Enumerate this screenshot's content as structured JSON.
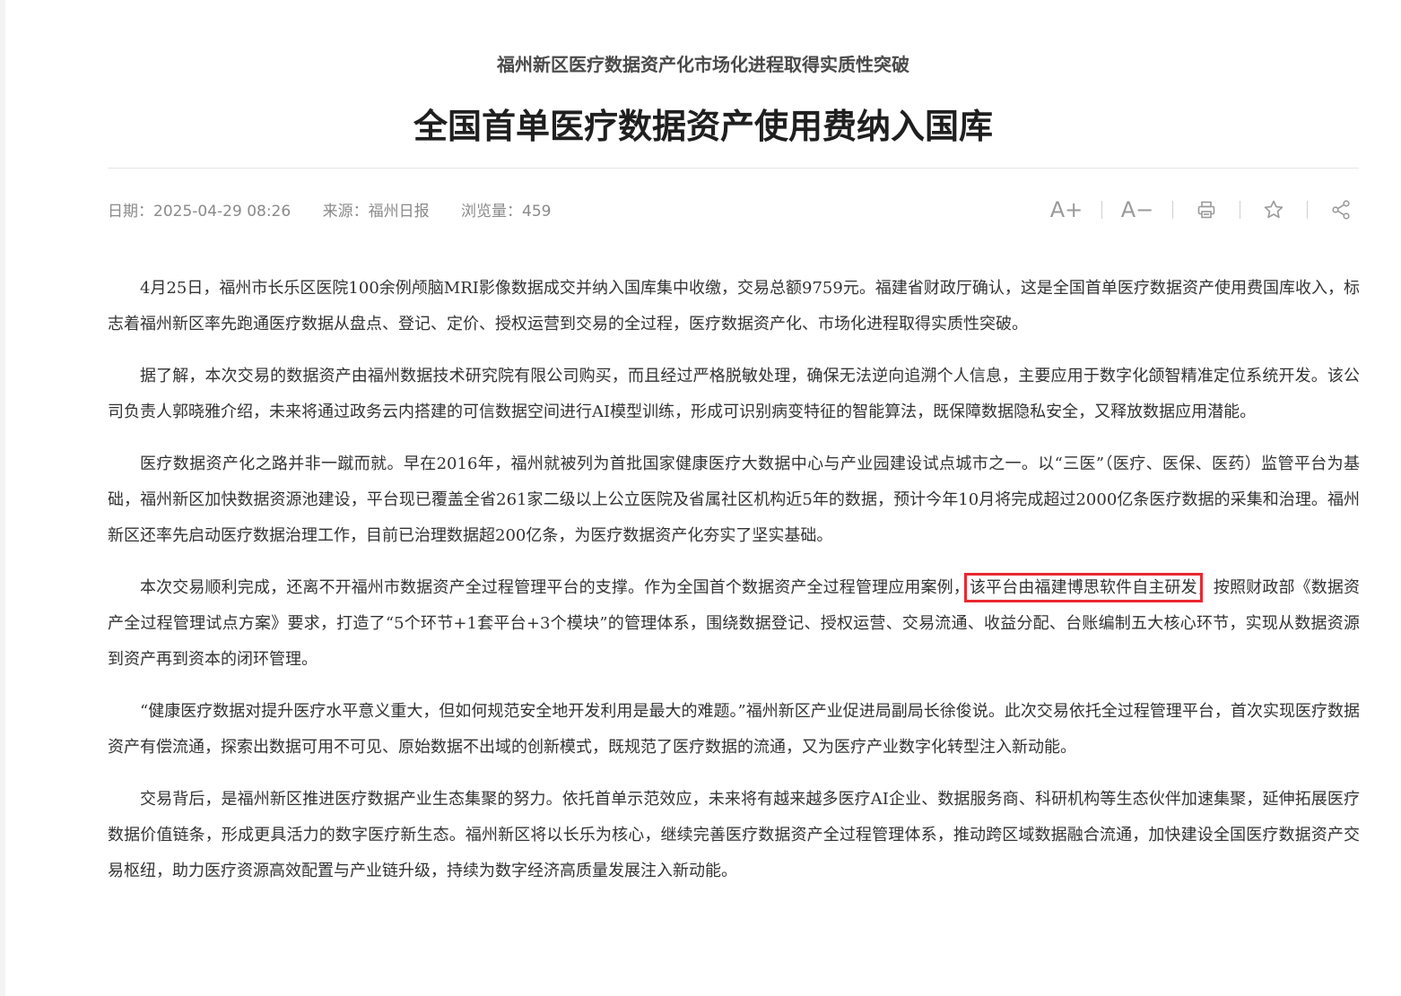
{
  "article": {
    "subtitle": "福州新区医疗数据资产化市场化进程取得实质性突破",
    "title": "全国首单医疗数据资产使用费纳入国库",
    "meta": {
      "date": "日期：2025-04-29 08:26",
      "source": "来源：福州日报",
      "views": "浏览量：459"
    },
    "toolbar": {
      "font_increase": "A+",
      "font_decrease": "A−"
    },
    "p1": "4月25日，福州市长乐区医院100余例颅脑MRI影像数据成交并纳入国库集中收缴，交易总额9759元。福建省财政厅确认，这是全国首单医疗数据资产使用费国库收入，标志着福州新区率先跑通医疗数据从盘点、登记、定价、授权运营到交易的全过程，医疗数据资产化、市场化进程取得实质性突破。",
    "p2": "据了解，本次交易的数据资产由福州数据技术研究院有限公司购买，而且经过严格脱敏处理，确保无法逆向追溯个人信息，主要应用于数字化颌智精准定位系统开发。该公司负责人郭晓雅介绍，未来将通过政务云内搭建的可信数据空间进行AI模型训练，形成可识别病变特征的智能算法，既保障数据隐私安全，又释放数据应用潜能。",
    "p3": "医疗数据资产化之路并非一蹴而就。早在2016年，福州就被列为首批国家健康医疗大数据中心与产业园建设试点城市之一。以“三医”（医疗、医保、医药）监管平台为基础，福州新区加快数据资源池建设，平台现已覆盖全省261家二级以上公立医院及省属社区机构近5年的数据，预计今年10月将完成超过2000亿条医疗数据的采集和治理。福州新区还率先启动医疗数据治理工作，目前已治理数据超200亿条，为医疗数据资产化夯实了坚实基础。",
    "p4_before": "本次交易顺利完成，还离不开福州市数据资产全过程管理平台的支撑。作为全国首个数据资产全过程管理应用案例，",
    "p4_highlight": "该平台由福建博思软件自主研发",
    "p4_after": "，按照财政部《数据资产全过程管理试点方案》要求，打造了“5个环节+1套平台+3个模块”的管理体系，围绕数据登记、授权运营、交易流通、收益分配、台账编制五大核心环节，实现从数据资源到资产再到资本的闭环管理。",
    "p5": "“健康医疗数据对提升医疗水平意义重大，但如何规范安全地开发利用是最大的难题。”福州新区产业促进局副局长徐俊说。此次交易依托全过程管理平台，首次实现医疗数据资产有偿流通，探索出数据可用不可见、原始数据不出域的创新模式，既规范了医疗数据的流通，又为医疗产业数字化转型注入新动能。",
    "p6": "交易背后，是福州新区推进医疗数据产业生态集聚的努力。依托首单示范效应，未来将有越来越多医疗AI企业、数据服务商、科研机构等生态伙伴加速集聚，延伸拓展医疗数据价值链条，形成更具活力的数字医疗新生态。福州新区将以长乐为核心，继续完善医疗数据资产全过程管理体系，推动跨区域数据融合流通，加快建设全国医疗数据资产交易枢纽，助力医疗资源高效配置与产业链升级，持续为数字经济高质量发展注入新动能。"
  },
  "colors": {
    "highlight_border": "#e8282f",
    "title": "#1f1f1f",
    "meta": "#8a8a8a"
  },
  "icons": [
    "print-icon",
    "star-icon",
    "share-icon"
  ]
}
